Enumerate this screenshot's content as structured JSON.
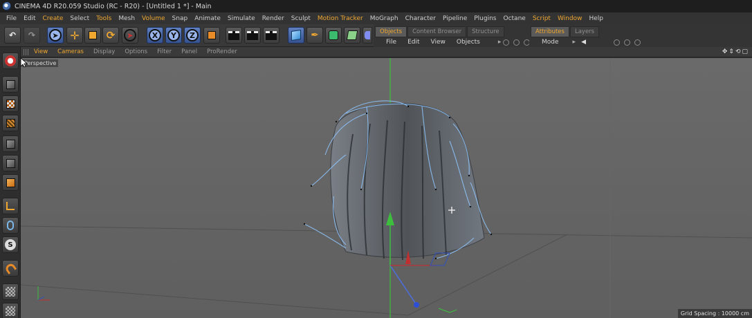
{
  "window": {
    "title": "CINEMA 4D R20.059 Studio (RC - R20) - [Untitled 1 *] - Main"
  },
  "menubar": {
    "items": [
      "File",
      "Edit",
      "Create",
      "Select",
      "Tools",
      "Mesh",
      "Volume",
      "Snap",
      "Animate",
      "Simulate",
      "Render",
      "Sculpt",
      "Motion Tracker",
      "MoGraph",
      "Character",
      "Pipeline",
      "Plugins",
      "Octane",
      "Script",
      "Window",
      "Help"
    ]
  },
  "toolbar": {
    "axis_x": "X",
    "axis_y": "Y",
    "axis_z": "Z"
  },
  "objects_panel": {
    "tabs": [
      "Objects",
      "Content Browser",
      "Structure"
    ],
    "menu": [
      "File",
      "Edit",
      "View",
      "Objects"
    ]
  },
  "attributes_panel": {
    "tabs": [
      "Attributes",
      "Layers"
    ],
    "menu": [
      "Mode"
    ]
  },
  "viewport": {
    "menu": [
      "View",
      "Cameras",
      "Display",
      "Options",
      "Filter",
      "Panel",
      "ProRender"
    ],
    "label": "Perspective",
    "grid_spacing": "Grid Spacing : 10000 cm"
  },
  "colors": {
    "accent": "#f0a830",
    "selection_blue": "#4e6fae",
    "hair_highlight": "#8fc6ff",
    "viewport_bg": "#6f6f6f"
  }
}
